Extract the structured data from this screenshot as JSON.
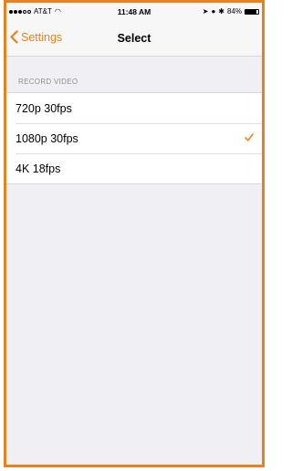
{
  "status_bar": {
    "carrier": "AT&T",
    "time": "11:48 AM",
    "battery": "84%"
  },
  "nav": {
    "back_label": "Settings",
    "title": "Select"
  },
  "section": {
    "header": "RECORD VIDEO",
    "items": [
      {
        "label": "720p 30fps",
        "selected": false
      },
      {
        "label": "1080p 30fps",
        "selected": true
      },
      {
        "label": "4K 18fps",
        "selected": false
      }
    ]
  },
  "colors": {
    "accent": "#e8821e",
    "background": "#efeff4"
  }
}
